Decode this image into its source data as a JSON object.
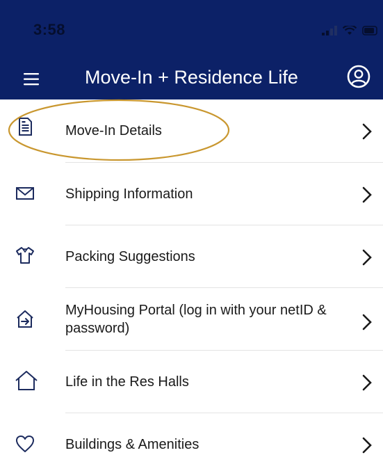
{
  "status_bar": {
    "time": "3:58"
  },
  "header": {
    "title": "Move-In + Residence Life",
    "menu_icon": "hamburger-menu-icon",
    "profile_icon": "user-account-icon",
    "background_color": "#0c2167"
  },
  "menu_items": [
    {
      "label": "Move-In Details",
      "icon": "document-list-icon"
    },
    {
      "label": "Shipping Information",
      "icon": "envelope-icon"
    },
    {
      "label": "Packing Suggestions",
      "icon": "shirt-icon"
    },
    {
      "label": "MyHousing Portal (log in with your netID & password)",
      "icon": "house-arrow-icon"
    },
    {
      "label": "Life in the Res Halls",
      "icon": "house-outline-icon"
    },
    {
      "label": "Buildings & Amenities",
      "icon": "heart-outline-icon"
    }
  ],
  "annotation": {
    "highlight_color": "#c9972f",
    "highlighted_item": "Move-In Details"
  }
}
